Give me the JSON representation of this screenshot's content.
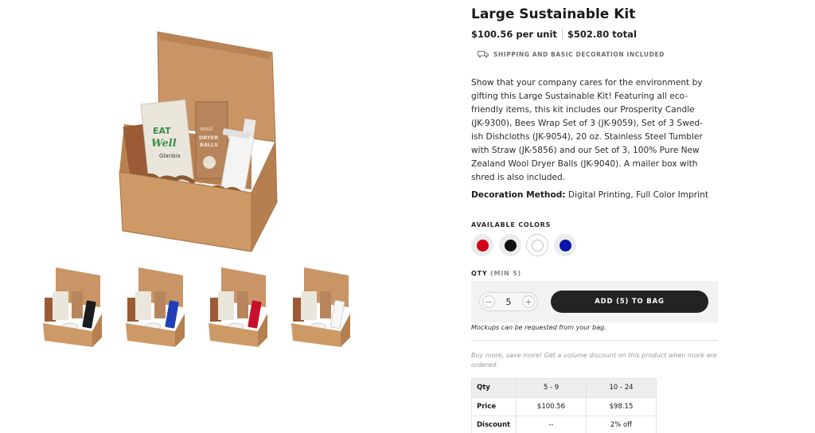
{
  "product": {
    "title": "Large Sustainable Kit",
    "price_per_unit": "$100.56 per unit",
    "price_total": "$502.80 total",
    "shipping_note": "SHIPPING AND BASIC DECORATION INCLUDED",
    "description": "Show that your company cares for the environment by gifting this Large Sustainable Kit! Featuring all eco-friendly items, this kit includes our Prosperity Candle (JK-9300), Bees Wrap Set of 3 (JK-9059), Set of 3 Swed-ish Dishcloths (JK-9054), 20 oz. Stainless Steel Tumbler with Straw (JK-5856) and our Set of 3, 100% Pure New Zealand Wool Dryer Balls (JK-9040). A mailer box with shred is also included.",
    "decoration_label": "Decoration Method:",
    "decoration_value": " Digital Printing, Full Color Imprint"
  },
  "colors": {
    "label": "AVAILABLE COLORS",
    "swatches": [
      {
        "name": "red",
        "hex": "#d0021b"
      },
      {
        "name": "black",
        "hex": "#111111"
      },
      {
        "name": "white",
        "hex": "#ffffff"
      },
      {
        "name": "blue",
        "hex": "#0a14a8"
      }
    ]
  },
  "quantity": {
    "label": "QTY",
    "min_label": "(MIN 5)",
    "value": "5",
    "decrement": "−",
    "increment": "+",
    "add_button": "ADD (5) TO BAG",
    "mockup_note": "Mockups can be requested from your bag."
  },
  "volume": {
    "note": "Buy more, save more! Get a volume discount on this product when more are ordered.",
    "header": [
      "Qty",
      "5 - 9",
      "10 - 24"
    ],
    "rows": [
      [
        "Price",
        "$100.56",
        "$98.15"
      ],
      [
        "Discount",
        "--",
        "2% off"
      ]
    ]
  },
  "images": {
    "main_text_top": "EAT",
    "main_text_mid": "Well",
    "main_brand": "Glanbia",
    "main_dryer_1": "DRYER",
    "main_dryer_2": "BALLS",
    "main_wool": "wool",
    "thumb_tumbler_colors": [
      "#1c1c1c",
      "#1f3fb8",
      "#c8102e",
      "#ffffff"
    ]
  }
}
